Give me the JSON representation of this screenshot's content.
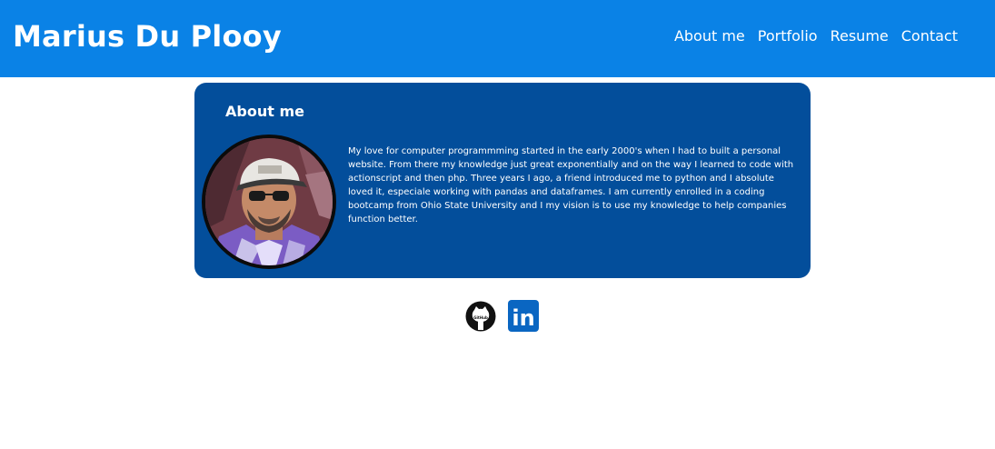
{
  "header": {
    "title": "Marius Du Plooy",
    "background_color": "#0a82e6",
    "nav": [
      {
        "label": "About me"
      },
      {
        "label": "Portfolio"
      },
      {
        "label": "Resume"
      },
      {
        "label": "Contact"
      }
    ]
  },
  "about": {
    "heading": "About me",
    "card_color": "#034e9b",
    "bio": "My love for computer programmming started in the early 2000's when I had to built a personal website. From there my knowledge just great exponentially and on the way I learned to code with actionscript and then php. Three years I ago, a friend introduced me to python and I absolute loved it, especiale working with pandas and dataframes. I am currently enrolled in a coding bootcamp from Ohio State University and I my vision is to use my knowledge to help companies function better."
  },
  "social": {
    "github": {
      "icon": "github-icon",
      "caption": "GitHub"
    },
    "linkedin": {
      "icon": "linkedin-icon",
      "label": "in",
      "color": "#0a66c2"
    }
  }
}
